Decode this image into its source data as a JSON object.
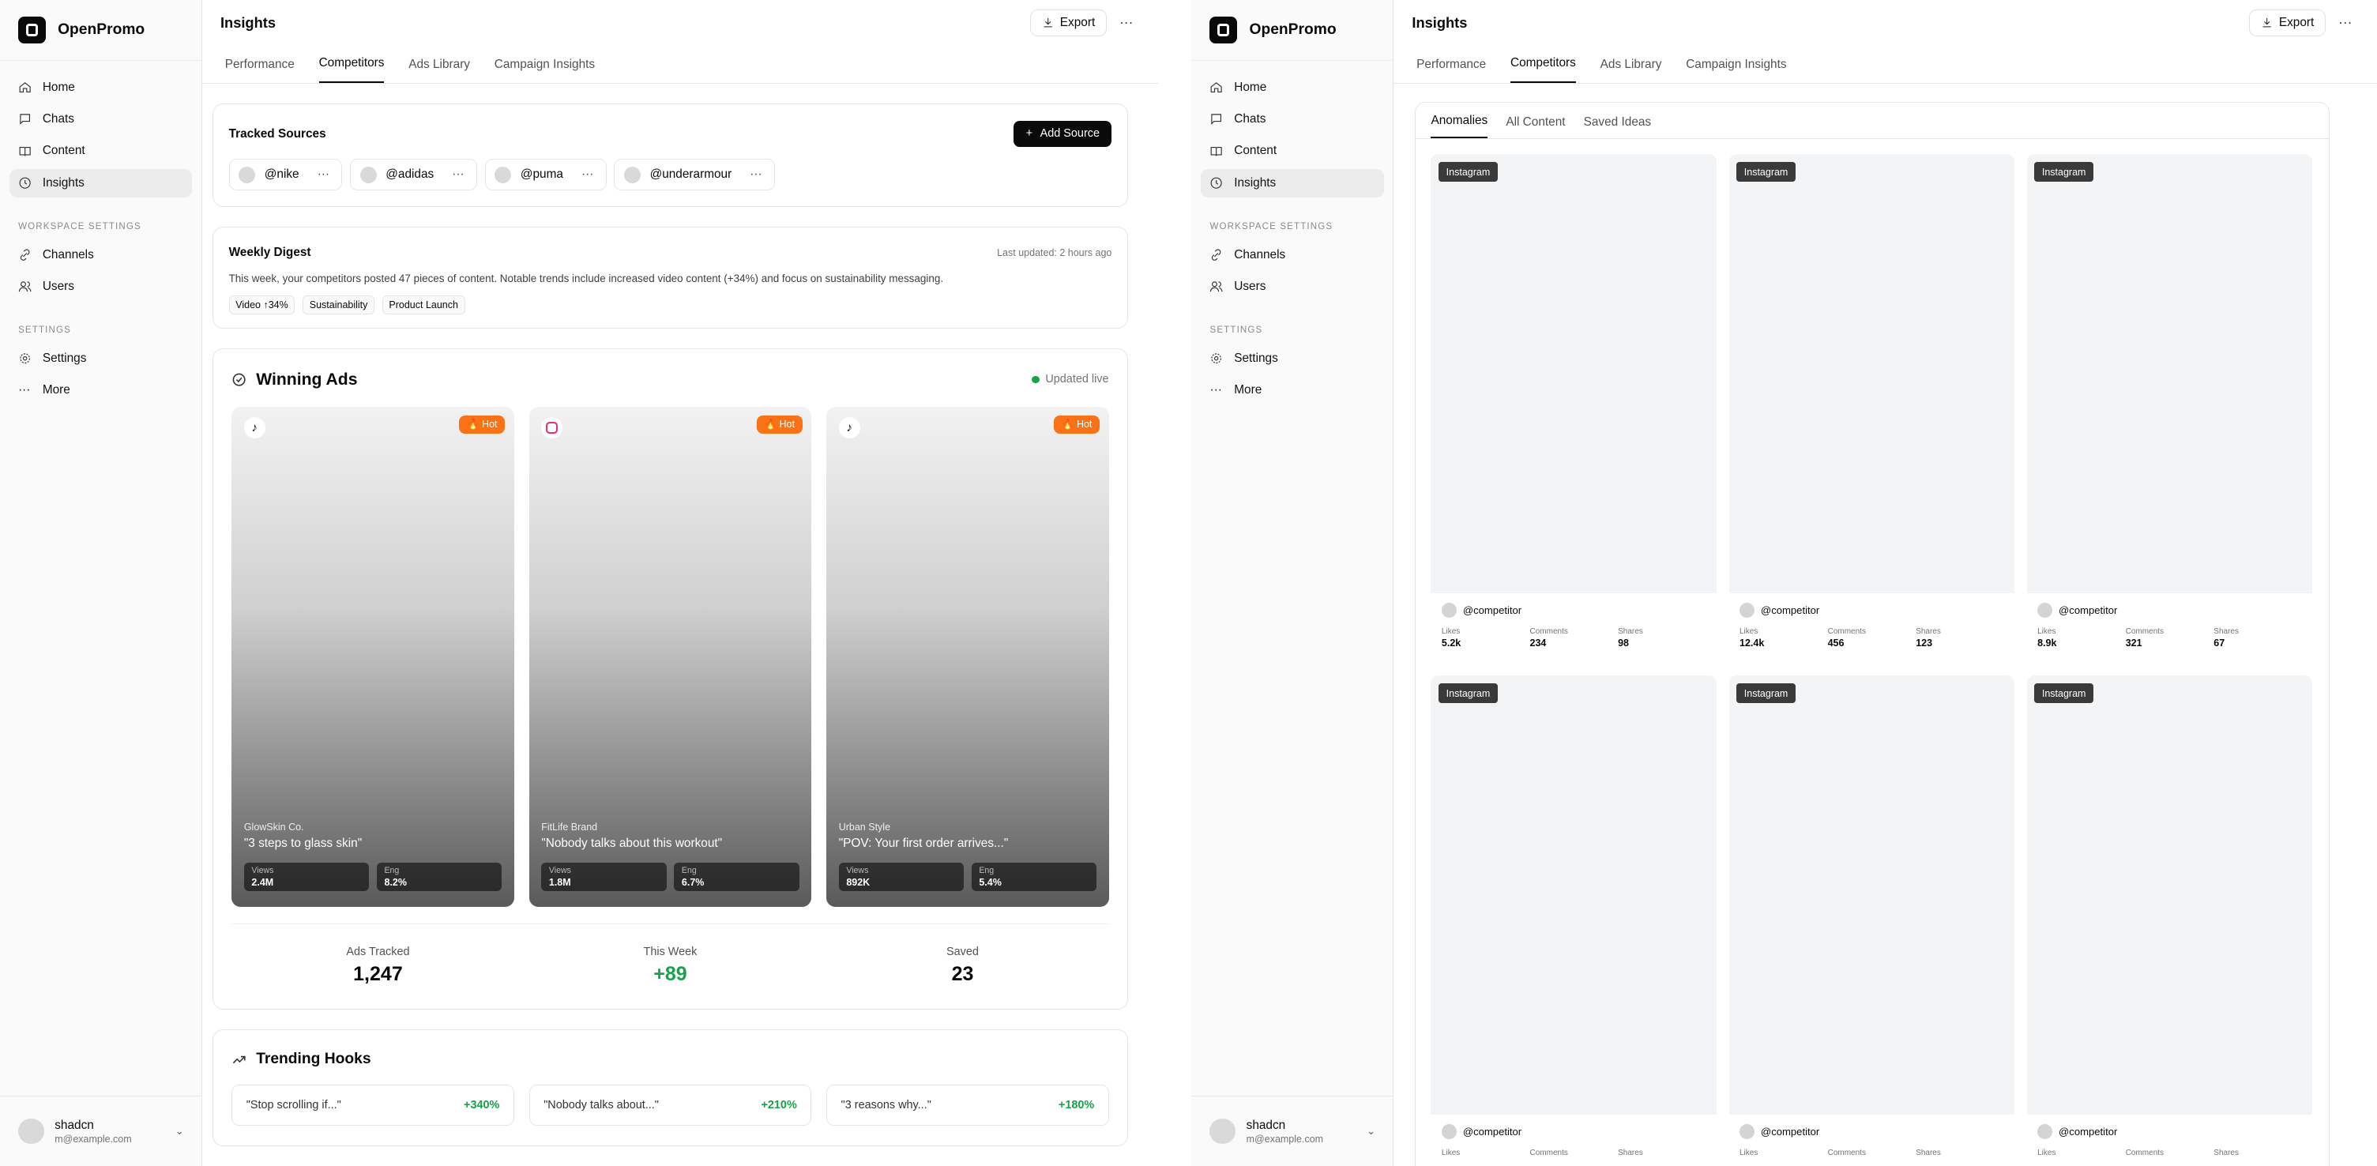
{
  "app": {
    "name": "OpenPromo"
  },
  "nav": {
    "items": [
      "Home",
      "Chats",
      "Content",
      "Insights"
    ],
    "workspace_group": "WORKSPACE SETTINGS",
    "workspace_items": [
      "Channels",
      "Users"
    ],
    "settings_group": "SETTINGS",
    "settings_items": [
      "Settings",
      "More"
    ]
  },
  "user": {
    "name": "shadcn",
    "email": "m@example.com"
  },
  "page": {
    "title": "Insights",
    "export_label": "Export",
    "more_label": "···"
  },
  "tabs": [
    "Performance",
    "Competitors",
    "Ads Library",
    "Campaign Insights"
  ],
  "tracked": {
    "title": "Tracked Sources",
    "add_label": "Add Source",
    "sources": [
      "@nike",
      "@adidas",
      "@puma",
      "@underarmour"
    ]
  },
  "digest": {
    "title": "Weekly Digest",
    "updated": "Last updated: 2 hours ago",
    "text": "This week, your competitors posted 47 pieces of content. Notable trends include increased video content (+34%) and focus on sustainability messaging.",
    "tags": [
      "Video ↑34%",
      "Sustainability",
      "Product Launch"
    ]
  },
  "winning": {
    "title": "Winning Ads",
    "status": "Updated live",
    "hot_label": "Hot",
    "views_label": "Views",
    "eng_label": "Eng",
    "ads": [
      {
        "platform": "tiktok",
        "brand": "GlowSkin Co.",
        "hook": "\"3 steps to glass skin\"",
        "views": "2.4M",
        "eng": "8.2%"
      },
      {
        "platform": "instagram",
        "brand": "FitLife Brand",
        "hook": "\"Nobody talks about this workout\"",
        "views": "1.8M",
        "eng": "6.7%"
      },
      {
        "platform": "tiktok",
        "brand": "Urban Style",
        "hook": "\"POV: Your first order arrives...\"",
        "views": "892K",
        "eng": "5.4%"
      }
    ],
    "summary": [
      {
        "label": "Ads Tracked",
        "value": "1,247"
      },
      {
        "label": "This Week",
        "value": "+89"
      },
      {
        "label": "Saved",
        "value": "23"
      }
    ]
  },
  "trending": {
    "title": "Trending Hooks",
    "hooks": [
      {
        "text": "\"Stop scrolling if...\"",
        "pct": "+340%"
      },
      {
        "text": "\"Nobody talks about...\"",
        "pct": "+210%"
      },
      {
        "text": "\"3 reasons why...\"",
        "pct": "+180%"
      }
    ]
  },
  "right": {
    "subtabs": [
      "Anomalies",
      "All Content",
      "Saved Ideas"
    ],
    "badge": "Instagram",
    "handle": "@competitor",
    "labels": {
      "likes": "Likes",
      "comments": "Comments",
      "shares": "Shares"
    },
    "posts": [
      {
        "likes": "5.2k",
        "comments": "234",
        "shares": "98"
      },
      {
        "likes": "12.4k",
        "comments": "456",
        "shares": "123"
      },
      {
        "likes": "8.9k",
        "comments": "321",
        "shares": "67"
      },
      {
        "likes": "",
        "comments": "",
        "shares": ""
      },
      {
        "likes": "",
        "comments": "",
        "shares": ""
      },
      {
        "likes": "",
        "comments": "",
        "shares": ""
      }
    ]
  },
  "colors": {
    "accent": "#0a0a0a",
    "hot": "#f97316",
    "positive": "#16a34a",
    "badge": "#3a3a3a"
  }
}
